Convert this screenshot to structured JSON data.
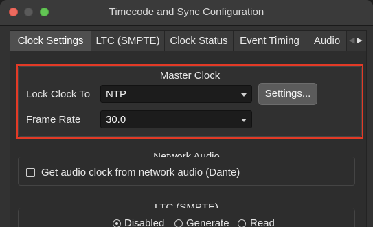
{
  "window": {
    "title": "Timecode and Sync Configuration"
  },
  "tabs": [
    {
      "label": "Clock Settings"
    },
    {
      "label": "LTC (SMPTE)"
    },
    {
      "label": "Clock Status"
    },
    {
      "label": "Event Timing"
    },
    {
      "label": "Audio"
    }
  ],
  "master_clock": {
    "title": "Master Clock",
    "lock_clock_label": "Lock Clock To",
    "lock_clock_value": "NTP",
    "settings_button": "Settings...",
    "frame_rate_label": "Frame Rate",
    "frame_rate_value": "30.0"
  },
  "network_audio": {
    "title": "Network Audio",
    "checkbox_label": "Get audio clock from network audio (Dante)",
    "checked": false
  },
  "ltc": {
    "title": "LTC (SMPTE)",
    "options": [
      {
        "label": "Disabled",
        "selected": true
      },
      {
        "label": "Generate",
        "selected": false
      },
      {
        "label": "Read",
        "selected": false
      }
    ]
  },
  "colors": {
    "highlight": "#e23a26",
    "close": "#ed6a5e",
    "zoom": "#62c554"
  }
}
